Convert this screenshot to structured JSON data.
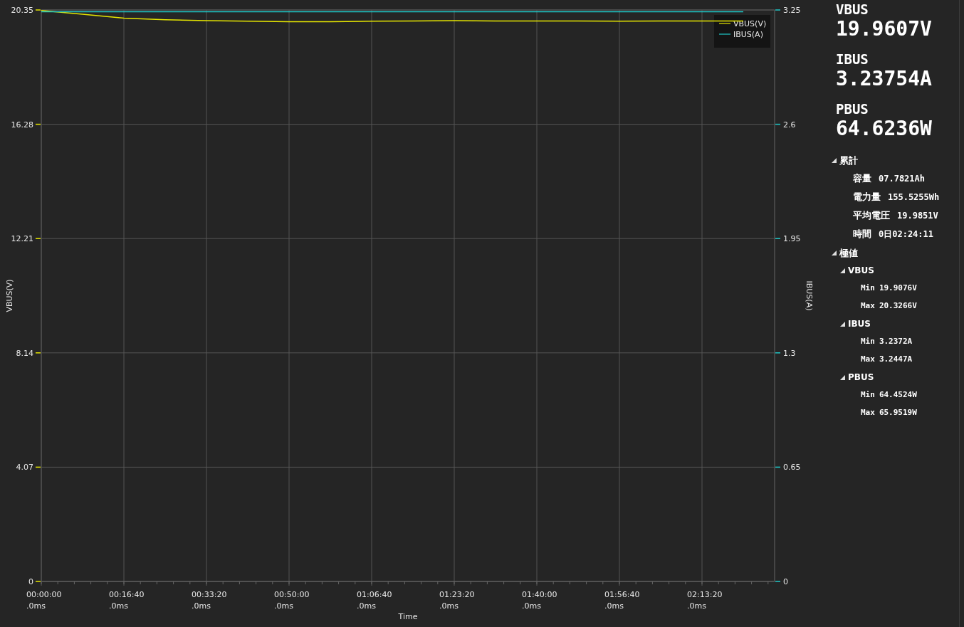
{
  "chart": {
    "chart_data": {
      "type": "line",
      "grid": true,
      "legend": "upper right",
      "xlabel": "Time",
      "ylabel": "VBUS(V)",
      "y2label": "IBUS(A)",
      "categories": [
        "00:00:00\n.0ms",
        null,
        "00:16:40\n.0ms",
        null,
        "00:33:20\n.0ms",
        null,
        "00:50:00\n.0ms",
        null,
        "01:06:40\n.0ms",
        null,
        "01:23:20\n.0ms",
        null,
        "01:40:00\n.0ms",
        null,
        "01:56:40\n.0ms",
        null,
        "02:13:20\n.0ms",
        null
      ],
      "series": [
        {
          "name": "VBUS(V)",
          "color": "#e6e600",
          "values": [
            20.33,
            20.2,
            20.06,
            20.0,
            19.97,
            19.95,
            19.93,
            19.93,
            19.95,
            19.96,
            19.97,
            19.96,
            19.96,
            19.96,
            19.95,
            19.96,
            19.96,
            19.96
          ]
        },
        {
          "name": "IBUS(A)",
          "color": "#1fc8c8",
          "axis": "y2",
          "values": [
            3.24,
            3.24,
            3.24,
            3.24,
            3.24,
            3.24,
            3.24,
            3.24,
            3.24,
            3.24,
            3.24,
            3.24,
            3.24,
            3.24,
            3.24,
            3.24,
            3.24,
            3.24
          ]
        }
      ],
      "ylim": [
        0,
        20.35
      ],
      "y2lim": [
        0,
        3.25
      ],
      "yticks": [
        0,
        4.07,
        8.14,
        12.21,
        16.28,
        20.35
      ],
      "y2ticks": [
        0,
        0.65,
        1.3,
        1.95,
        2.6,
        3.25
      ]
    }
  },
  "readings": [
    {
      "label": "VBUS",
      "value": "19.9607V"
    },
    {
      "label": "IBUS",
      "value": "3.23754A"
    },
    {
      "label": "PBUS",
      "value": "64.6236W"
    }
  ],
  "tree": [
    {
      "label": "累計",
      "expanded": true,
      "children": [
        {
          "label": "容量",
          "value": "07.7821Ah"
        },
        {
          "label": "電力量",
          "value": "155.5255Wh"
        },
        {
          "label": "平均電圧",
          "value": "19.9851V"
        },
        {
          "label": "時間",
          "value": "0日02:24:11"
        }
      ]
    },
    {
      "label": "極値",
      "expanded": true,
      "children": [
        {
          "label": "VBUS",
          "expanded": true,
          "children": [
            {
              "label": "Min",
              "value": "19.9076V"
            },
            {
              "label": "Max",
              "value": "20.3266V"
            }
          ]
        },
        {
          "label": "IBUS",
          "expanded": true,
          "children": [
            {
              "label": "Min",
              "value": "3.2372A"
            },
            {
              "label": "Max",
              "value": "3.2447A"
            }
          ]
        },
        {
          "label": "PBUS",
          "expanded": true,
          "children": [
            {
              "label": "Min",
              "value": "64.4524W"
            },
            {
              "label": "Max",
              "value": "65.9519W"
            }
          ]
        }
      ]
    }
  ]
}
